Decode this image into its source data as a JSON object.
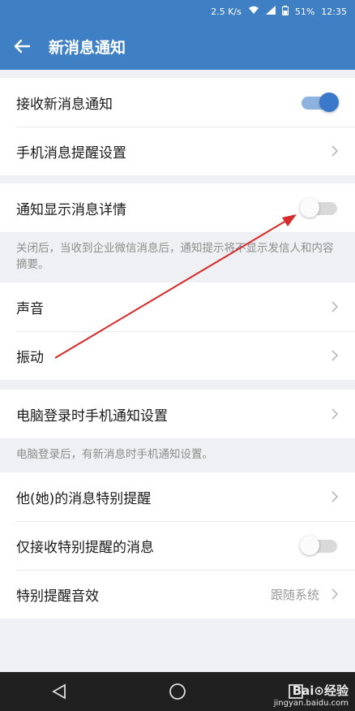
{
  "status": {
    "speed": "2.5 K/s",
    "battery": "51%",
    "time": "12:35"
  },
  "header": {
    "title": "新消息通知"
  },
  "group1": [
    {
      "label": "接收新消息通知",
      "toggle": "on"
    },
    {
      "label": "手机消息提醒设置"
    }
  ],
  "group2": {
    "label": "通知显示消息详情",
    "toggle": "off",
    "note": "关闭后，当收到企业微信消息后，通知提示将不显示发信人和内容摘要。"
  },
  "group3": [
    {
      "label": "声音"
    },
    {
      "label": "振动"
    }
  ],
  "group4": {
    "label": "电脑登录时手机通知设置",
    "note": "电脑登录后，有新消息时手机通知设置。"
  },
  "group5": [
    {
      "label": "他(她)的消息特别提醒"
    },
    {
      "label": "仅接收特别提醒的消息",
      "toggle": "off"
    },
    {
      "label": "特别提醒音效",
      "value": "跟随系统"
    }
  ],
  "watermark": {
    "brand": "Bai⊙经验",
    "url": "jingyan.baidu.com"
  },
  "colors": {
    "primary": "#3f7fc3",
    "annotation": "#d62b2b"
  }
}
